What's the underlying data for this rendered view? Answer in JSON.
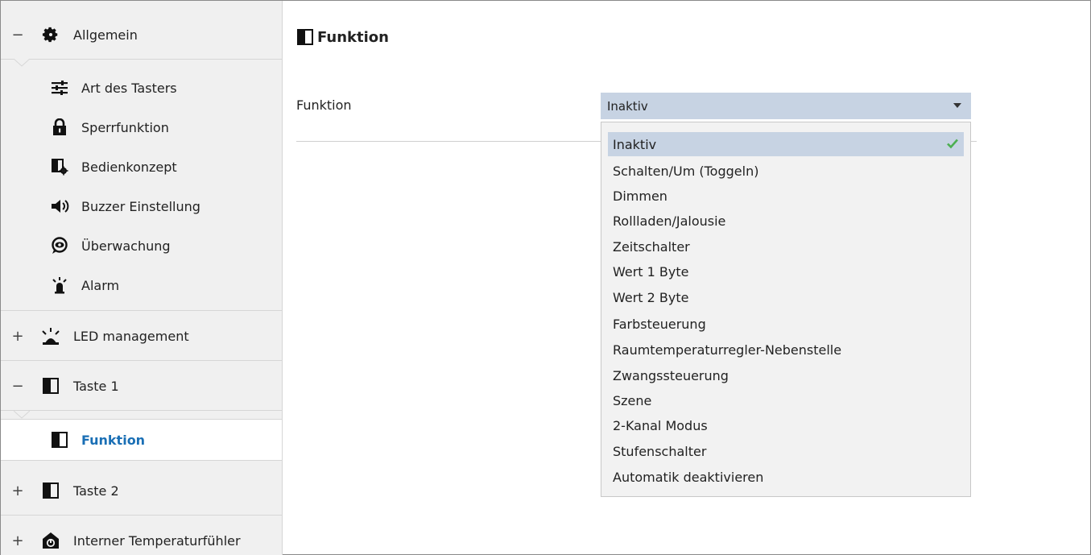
{
  "sidebar": {
    "groups": [
      {
        "toggle": "−",
        "label": "Allgemein",
        "icon": "gear-icon"
      },
      {
        "toggle": "+",
        "label": "LED management",
        "icon": "led-icon"
      },
      {
        "toggle": "−",
        "label": "Taste 1",
        "icon": "button-panel-icon"
      },
      {
        "toggle": "+",
        "label": "Taste 2",
        "icon": "button-panel-icon"
      },
      {
        "toggle": "+",
        "label": "Interner Temperaturfühler",
        "icon": "thermometer-house-icon"
      }
    ],
    "allgemein_items": [
      {
        "label": "Art des Tasters",
        "icon": "sliders-icon"
      },
      {
        "label": "Sperrfunktion",
        "icon": "lock-icon"
      },
      {
        "label": "Bedienkonzept",
        "icon": "concept-gear-icon"
      },
      {
        "label": "Buzzer Einstellung",
        "icon": "speaker-icon"
      },
      {
        "label": "Überwachung",
        "icon": "eye-icon"
      },
      {
        "label": "Alarm",
        "icon": "alarm-icon"
      }
    ],
    "selected_item": {
      "label": "Funktion",
      "icon": "button-panel-icon"
    }
  },
  "main": {
    "title": "Funktion",
    "param_label": "Funktion",
    "select_value": "Inaktiv",
    "options": [
      "Inaktiv",
      "Schalten/Um (Toggeln)",
      "Dimmen",
      "Rollladen/Jalousie",
      "Zeitschalter",
      "Wert 1 Byte",
      "Wert 2 Byte",
      "Farbsteuerung",
      "Raumtemperaturregler-Nebenstelle",
      "Zwangssteuerung",
      "Szene",
      "2-Kanal Modus",
      "Stufenschalter",
      "Automatik deaktivieren"
    ]
  },
  "colors": {
    "accent": "#1a6fb5",
    "selection": "#c7d3e3",
    "check": "#4caf50"
  }
}
